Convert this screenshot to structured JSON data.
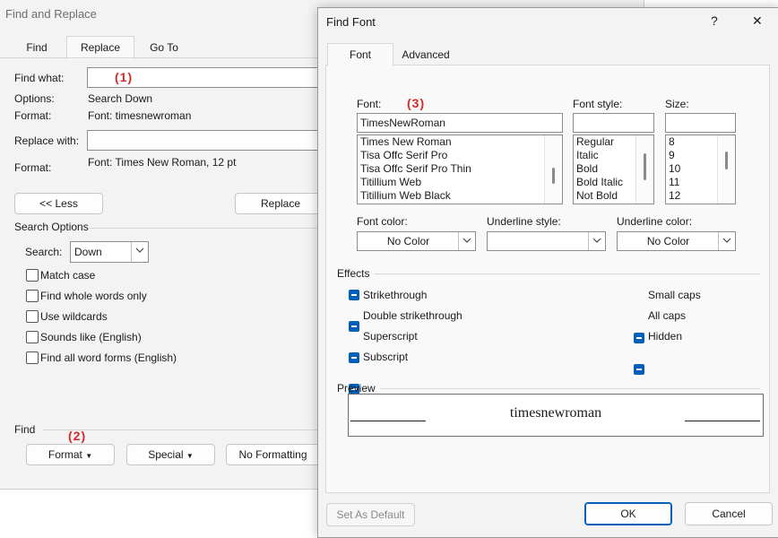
{
  "find_replace": {
    "title": "Find and Replace",
    "tabs": [
      "Find",
      "Replace",
      "Go To"
    ],
    "find_what_label": "Find what:",
    "find_what_value": "",
    "options_label": "Options:",
    "options_value": "Search Down",
    "format_label": "Format:",
    "format_value": "Font: timesnewroman",
    "replace_with_label": "Replace with:",
    "replace_with_value": "",
    "format2_label": "Format:",
    "format2_value": "Font: Times New Roman, 12 pt",
    "less_button": "<< Less",
    "replace_button": "Replace",
    "search_options_heading": "Search Options",
    "search_label": "Search:",
    "search_value": "Down",
    "checkboxes": [
      "Match case",
      "Find whole words only",
      "Use wildcards",
      "Sounds like (English)",
      "Find all word forms (English)"
    ],
    "find_heading": "Find",
    "format_button": "Format",
    "special_button": "Special",
    "no_formatting_button": "No Formatting"
  },
  "annotations": [
    "(1)",
    "(2)",
    "(3)"
  ],
  "find_font": {
    "title": "Find Font",
    "help": "?",
    "close": "✕",
    "tabs": [
      "Font",
      "Advanced"
    ],
    "font_label": "Font:",
    "font_value": "TimesNewRoman",
    "font_list": [
      "Times New Roman",
      "Tisa Offc Serif Pro",
      "Tisa Offc Serif Pro Thin",
      "Titillium Web",
      "Titillium Web Black"
    ],
    "style_label": "Font style:",
    "style_value": "",
    "style_list": [
      "Regular",
      "Italic",
      "Bold",
      "Bold Italic",
      "Not Bold"
    ],
    "size_label": "Size:",
    "size_value": "",
    "size_list": [
      "8",
      "9",
      "10",
      "11",
      "12"
    ],
    "font_color_label": "Font color:",
    "font_color_value": "No Color",
    "underline_style_label": "Underline style:",
    "underline_style_value": "",
    "underline_color_label": "Underline color:",
    "underline_color_value": "No Color",
    "effects_heading": "Effects",
    "effects_left": [
      "Strikethrough",
      "Double strikethrough",
      "Superscript",
      "Subscript"
    ],
    "effects_right": [
      "Small caps",
      "All caps",
      "Hidden"
    ],
    "preview_heading": "Preview",
    "preview_text": "timesnewroman",
    "set_default_button": "Set As Default",
    "ok_button": "OK",
    "cancel_button": "Cancel"
  },
  "colors": {
    "accent": "#005fb8",
    "annotation_red": "#d62828"
  }
}
